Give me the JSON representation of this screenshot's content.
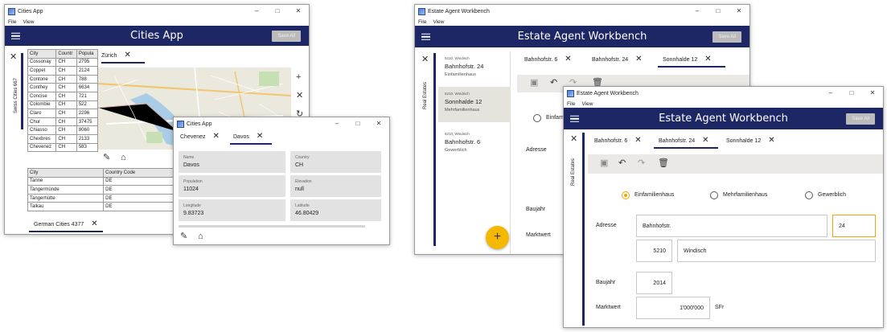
{
  "cities_main": {
    "title": "Cities App",
    "menu": [
      "File",
      "View"
    ],
    "app_title": "Cities App",
    "save_label": "Save All",
    "side_label": "Swiss Cities 667",
    "swiss_headers": [
      "City",
      "Countr",
      "Popula"
    ],
    "swiss_rows": [
      [
        "Cossonay",
        "CH",
        "2795"
      ],
      [
        "Coppet",
        "CH",
        "2124"
      ],
      [
        "Contone",
        "CH",
        "788"
      ],
      [
        "Conthey",
        "CH",
        "6634"
      ],
      [
        "Concise",
        "CH",
        "721"
      ],
      [
        "Colombie",
        "CH",
        "522"
      ],
      [
        "Claro",
        "CH",
        "2296"
      ],
      [
        "Chur",
        "CH",
        "37475"
      ],
      [
        "Chiasso",
        "CH",
        "8060"
      ],
      [
        "Chexbres",
        "CH",
        "2133"
      ],
      [
        "Chevenez",
        "CH",
        "583"
      ]
    ],
    "map_tab": "Zürich",
    "german_headers": [
      "City",
      "Country Code"
    ],
    "german_rows": [
      [
        "Tanne",
        "DE"
      ],
      [
        "Tangermünde",
        "DE"
      ],
      [
        "Tangerhütte",
        "DE"
      ],
      [
        "Talkau",
        "DE"
      ]
    ],
    "german_tab": "German Cities 4377"
  },
  "cities_popup": {
    "title": "Cities App",
    "tabs": [
      "Chevenez",
      "Davos"
    ],
    "fields": [
      {
        "label": "Name",
        "value": "Davos"
      },
      {
        "label": "Country",
        "value": "CH"
      },
      {
        "label": "Population",
        "value": "11024"
      },
      {
        "label": "Elevation",
        "value": "null"
      },
      {
        "label": "Longitude",
        "value": "9.83723"
      },
      {
        "label": "Latitude",
        "value": "46.80429"
      }
    ]
  },
  "estate_main": {
    "title": "Estate Agent Workbench",
    "menu": [
      "File",
      "View"
    ],
    "app_title": "Estate Agent Workbench",
    "save_label": "Save All",
    "side_label": "Real Estates",
    "list": [
      {
        "zip": "5210, Windisch",
        "street": "Bahnhofstr. 24",
        "type": "Einfamilienhaus"
      },
      {
        "zip": "5210, Windisch",
        "street": "Sonnhalde 12",
        "type": "Mehrfamilienhaus"
      },
      {
        "zip": "5210, Windisch",
        "street": "Bahnhofstr. 6",
        "type": "Gewerblich"
      }
    ],
    "tabs": [
      "Bahnhofstr. 6",
      "Bahnhofstr. 24",
      "Sonnhalde 12"
    ],
    "radio_first": "Einfam",
    "adresse": "Adresse",
    "baujahr": "Baujahr",
    "marktwert": "Marktwert",
    "fab": "+"
  },
  "estate_front": {
    "title": "Estate Agent Workbench",
    "menu": [
      "File",
      "View"
    ],
    "app_title": "Estate Agent Workbench",
    "save_label": "Save All",
    "side_label": "Real Estates",
    "tabs": [
      "Bahnhofstr. 6",
      "Bahnhofstr. 24",
      "Sonnhalde 12"
    ],
    "radios": [
      "Einfamilienhaus",
      "Mehrfamilienhaus",
      "Gewerblich"
    ],
    "labels": {
      "adresse": "Adresse",
      "baujahr": "Baujahr",
      "marktwert": "Marktwert"
    },
    "street": "Bahnhofstr.",
    "number": "24",
    "zip": "5210",
    "city": "Windisch",
    "year": "2014",
    "value": "1'000'000",
    "currency": "SFr"
  },
  "colors": {
    "appbar": "#1d2766",
    "accent": "#f0a500",
    "fab": "#f5b800"
  }
}
